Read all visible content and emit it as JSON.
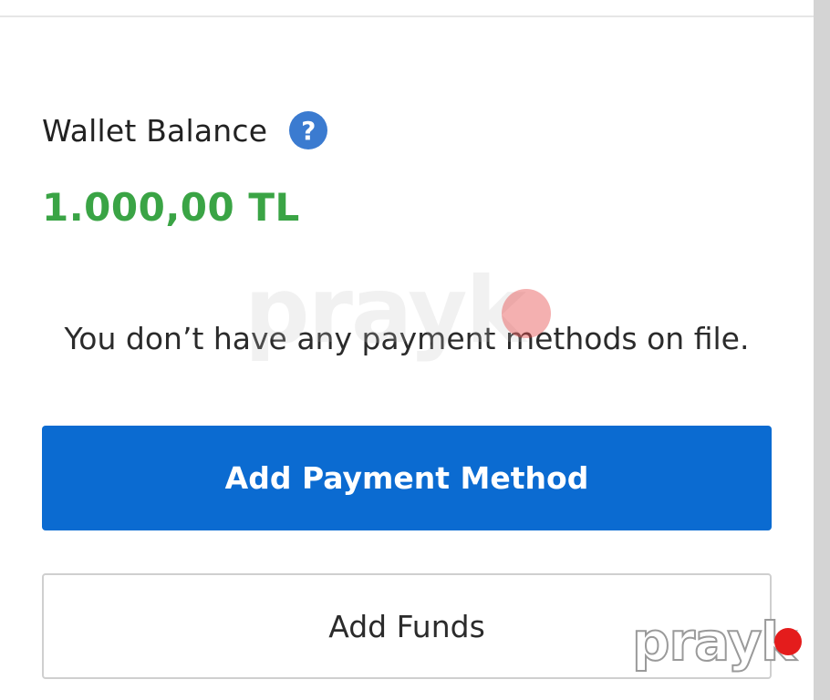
{
  "wallet": {
    "label": "Wallet Balance",
    "help_icon": "question-circle-icon",
    "help_glyph": "?",
    "amount": "1.000,00 TL"
  },
  "payment": {
    "empty_message": "You don’t have any payment methods on file.",
    "add_payment_label": "Add Payment Method",
    "add_funds_label": "Add Funds"
  },
  "watermark": {
    "text": "prayk"
  },
  "colors": {
    "primary": "#0b6bd1",
    "balance_green": "#3aa445",
    "help_blue": "#3b7bd0",
    "watermark_dot": "#e41c1c"
  }
}
